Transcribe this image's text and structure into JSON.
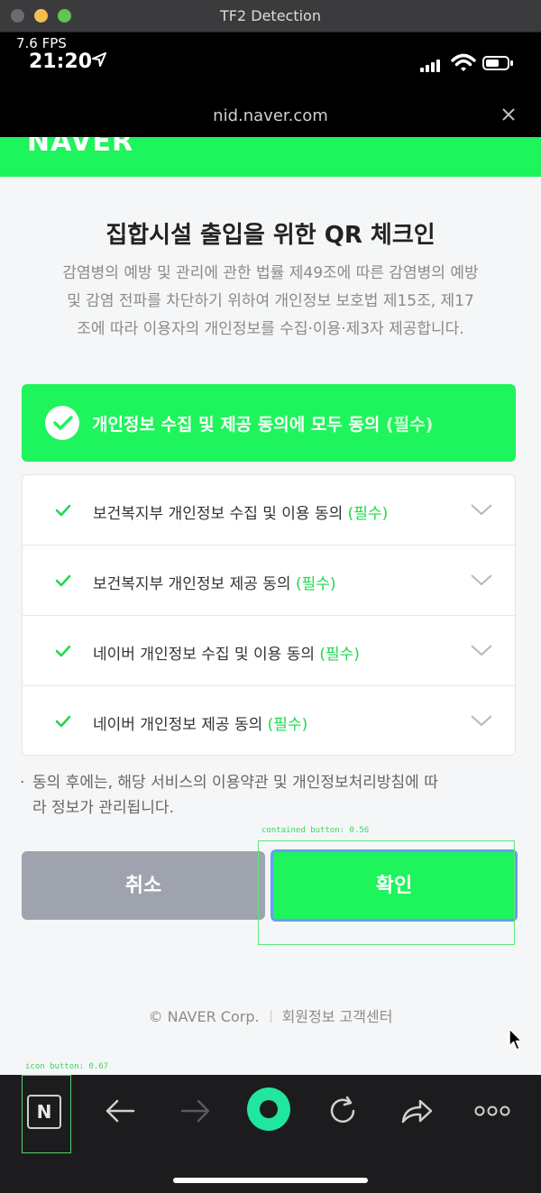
{
  "window": {
    "title": "TF2 Detection"
  },
  "status": {
    "fps": "7.6 FPS",
    "time": "21:20"
  },
  "browser": {
    "url": "nid.naver.com"
  },
  "brand": {
    "logo": "NAVER",
    "green": "#1ef45b",
    "required_green": "#1ed84f"
  },
  "page": {
    "title": "집합시설 출입을 위한 QR 체크인",
    "intro_lines": [
      "감염병의 예방 및 관리에 관한 법률 제49조에 따른 감염병의 예방",
      "및 감염 전파를 차단하기 위하여 개인정보 보호법 제15조, 제17",
      "조에 따라 이용자의 개인정보를 수집·이용·제3자 제공합니다."
    ],
    "all_agree": {
      "label": "개인정보 수집 및 제공 동의에 모두 동의",
      "required": "(필수)"
    },
    "items": [
      {
        "label": "보건복지부 개인정보 수집 및 이용 동의",
        "required": "(필수)"
      },
      {
        "label": "보건복지부 개인정보 제공 동의",
        "required": "(필수)"
      },
      {
        "label": "네이버 개인정보 수집 및 이용 동의",
        "required": "(필수)"
      },
      {
        "label": "네이버 개인정보 제공 동의",
        "required": "(필수)"
      }
    ],
    "notice_bullet": "·",
    "notice_lines": [
      "동의 후에는, 해당 서비스의 이용약관 및 개인정보처리방침에 따",
      "라 정보가 관리됩니다."
    ],
    "cancel_label": "취소",
    "confirm_label": "확인",
    "footer": {
      "copyright": "© NAVER Corp.",
      "help": "회원정보 고객센터"
    }
  },
  "detections": {
    "confirm": "contained button: 0.56",
    "toolbar_n": "icon button: 0.67"
  },
  "toolbar": {
    "naver_letter": "N"
  }
}
